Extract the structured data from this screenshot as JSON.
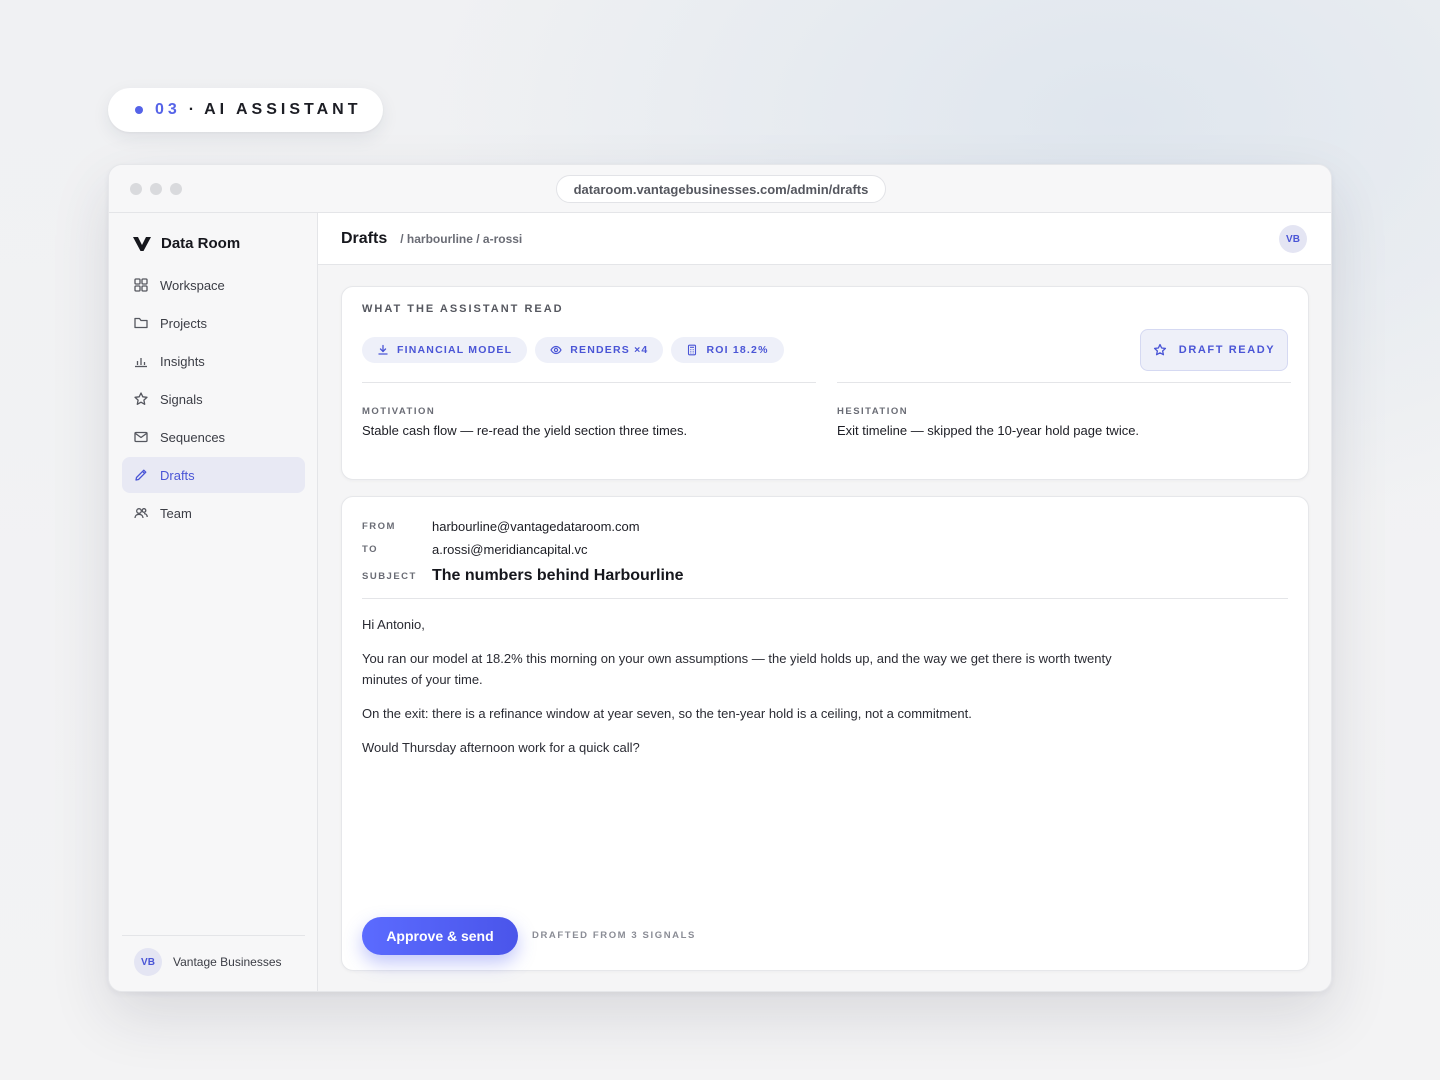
{
  "label": {
    "number": "03",
    "separator": "·",
    "text": "AI ASSISTANT"
  },
  "browser": {
    "url": "dataroom.vantagebusinesses.com/admin/drafts"
  },
  "sidebar": {
    "brand": "Data Room",
    "items": [
      {
        "label": "Workspace",
        "icon": "grid-icon",
        "active": false
      },
      {
        "label": "Projects",
        "icon": "folder-icon",
        "active": false
      },
      {
        "label": "Insights",
        "icon": "bar-chart-icon",
        "active": false
      },
      {
        "label": "Signals",
        "icon": "star-icon",
        "active": false
      },
      {
        "label": "Sequences",
        "icon": "mail-icon",
        "active": false
      },
      {
        "label": "Drafts",
        "icon": "pencil-icon",
        "active": true
      },
      {
        "label": "Team",
        "icon": "users-icon",
        "active": false
      }
    ],
    "footer": {
      "initials": "VB",
      "name": "Vantage Businesses"
    }
  },
  "header": {
    "title": "Drafts",
    "breadcrumb": "/ harbourline / a-rossi",
    "avatar": "VB"
  },
  "assistant_read": {
    "heading": "WHAT THE ASSISTANT READ",
    "chips": [
      {
        "label": "FINANCIAL MODEL",
        "icon": "download-icon"
      },
      {
        "label": "RENDERS ×4",
        "icon": "eye-icon"
      },
      {
        "label": "ROI 18.2%",
        "icon": "calculator-icon"
      }
    ],
    "status": "DRAFT READY",
    "motivation": {
      "label": "MOTIVATION",
      "value": "Stable cash flow — re-read the yield section three times."
    },
    "hesitation": {
      "label": "HESITATION",
      "value": "Exit timeline — skipped the 10-year hold page twice."
    }
  },
  "email": {
    "from_label": "FROM",
    "from": "harbourline@vantagedataroom.com",
    "to_label": "TO",
    "to": "a.rossi@meridiancapital.vc",
    "subject_label": "SUBJECT",
    "subject": "The numbers behind Harbourline",
    "body": [
      "Hi Antonio,",
      "You ran our model at 18.2% this morning on your own assumptions — the yield holds up, and the way we get there is worth twenty minutes of your time.",
      "On the exit: there is a refinance window at year seven, so the ten-year hold is a ceiling, not a commitment.",
      "Would Thursday afternoon work for a quick call?"
    ],
    "approve_label": "Approve & send",
    "drafted_note": "DRAFTED FROM 3 SIGNALS"
  },
  "colors": {
    "accent": "#4a55d6",
    "button": "#5563e8"
  }
}
